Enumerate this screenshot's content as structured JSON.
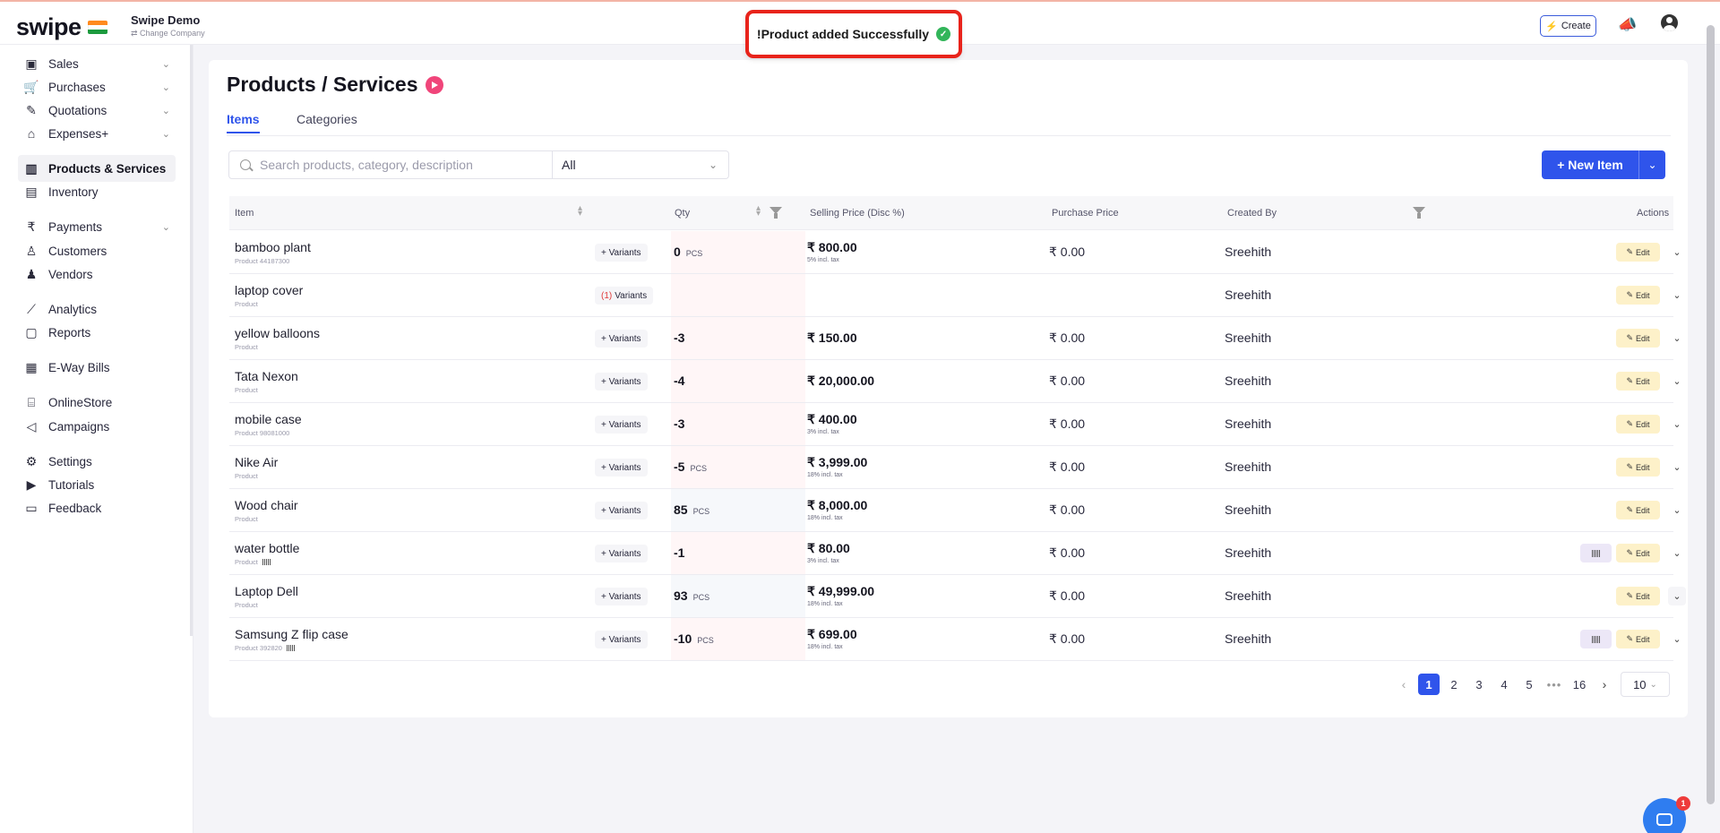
{
  "app": {
    "logo": "swipe",
    "company_name": "Swipe Demo",
    "change_company": "⇄ Change Company"
  },
  "toast": {
    "message": "!Product added Successfully"
  },
  "topbar": {
    "create_label": "Create"
  },
  "sidebar": {
    "items": [
      {
        "label": "Sales",
        "icon": "money-icon",
        "chevron": true
      },
      {
        "label": "Purchases",
        "icon": "cart-icon",
        "chevron": true
      },
      {
        "label": "Quotations",
        "icon": "pen-icon",
        "chevron": true
      },
      {
        "label": "Expenses+",
        "icon": "tag-icon",
        "chevron": true
      },
      {
        "label": "Products & Services",
        "icon": "barcode-icon",
        "chevron": false,
        "active": true
      },
      {
        "label": "Inventory",
        "icon": "inventory-icon",
        "chevron": false
      },
      {
        "label": "Payments",
        "icon": "rupee-icon",
        "chevron": true
      },
      {
        "label": "Customers",
        "icon": "user-icon",
        "chevron": false
      },
      {
        "label": "Vendors",
        "icon": "users-icon",
        "chevron": false
      },
      {
        "label": "Analytics",
        "icon": "chart-icon",
        "chevron": false
      },
      {
        "label": "Reports",
        "icon": "report-icon",
        "chevron": false
      },
      {
        "label": "E-Way Bills",
        "icon": "truck-icon",
        "chevron": false
      },
      {
        "label": "OnlineStore",
        "icon": "store-icon",
        "chevron": false
      },
      {
        "label": "Campaigns",
        "icon": "megaphone-icon",
        "chevron": false
      },
      {
        "label": "Settings",
        "icon": "gear-icon",
        "chevron": false
      },
      {
        "label": "Tutorials",
        "icon": "video-icon",
        "chevron": false
      },
      {
        "label": "Feedback",
        "icon": "chat-icon",
        "chevron": false
      }
    ]
  },
  "page": {
    "title": "Products / Services"
  },
  "tabs": [
    {
      "label": "Items",
      "active": true
    },
    {
      "label": "Categories",
      "active": false
    }
  ],
  "search": {
    "placeholder": "Search products, category, description",
    "filter_value": "All"
  },
  "actions": {
    "new_item_label": "+ New Item"
  },
  "table": {
    "headers": {
      "item": "Item",
      "qty": "Qty",
      "selling_price": "Selling Price (Disc %)",
      "purchase_price": "Purchase Price",
      "created_by": "Created By",
      "actions": "Actions"
    },
    "variants_label": "+ Variants",
    "edit_label": "Edit",
    "rows": [
      {
        "name": "bamboo plant",
        "sub": "Product  44187300",
        "barcode": false,
        "variants_count": "",
        "qty": "0",
        "unit": "PCS",
        "selling": "₹ 800.00",
        "tax": "5% incl. tax",
        "purchase": "₹ 0.00",
        "created_by": "Sreehith",
        "barcode_btn": false,
        "qty_tone": "neg"
      },
      {
        "name": "laptop cover",
        "sub": "Product",
        "barcode": false,
        "variants_count": "(1)",
        "qty": "",
        "unit": "",
        "selling": "",
        "tax": "",
        "purchase": "",
        "created_by": "Sreehith",
        "barcode_btn": false,
        "qty_tone": "neg"
      },
      {
        "name": "yellow balloons",
        "sub": "Product",
        "barcode": false,
        "variants_count": "",
        "qty": "-3",
        "unit": "",
        "selling": "₹ 150.00",
        "tax": "",
        "purchase": "₹ 0.00",
        "created_by": "Sreehith",
        "barcode_btn": false,
        "qty_tone": "neg"
      },
      {
        "name": "Tata Nexon",
        "sub": "Product",
        "barcode": false,
        "variants_count": "",
        "qty": "-4",
        "unit": "",
        "selling": "₹ 20,000.00",
        "tax": "",
        "purchase": "₹ 0.00",
        "created_by": "Sreehith",
        "barcode_btn": false,
        "qty_tone": "neg"
      },
      {
        "name": "mobile case",
        "sub": "Product  98081000",
        "barcode": false,
        "variants_count": "",
        "qty": "-3",
        "unit": "",
        "selling": "₹ 400.00",
        "tax": "3% incl. tax",
        "purchase": "₹ 0.00",
        "created_by": "Sreehith",
        "barcode_btn": false,
        "qty_tone": "neg"
      },
      {
        "name": "Nike Air",
        "sub": "Product",
        "barcode": false,
        "variants_count": "",
        "qty": "-5",
        "unit": "PCS",
        "selling": "₹ 3,999.00",
        "tax": "18% incl. tax",
        "purchase": "₹ 0.00",
        "created_by": "Sreehith",
        "barcode_btn": false,
        "qty_tone": "neg"
      },
      {
        "name": "Wood chair",
        "sub": "Product",
        "barcode": false,
        "variants_count": "",
        "qty": "85",
        "unit": "PCS",
        "selling": "₹ 8,000.00",
        "tax": "18% incl. tax",
        "purchase": "₹ 0.00",
        "created_by": "Sreehith",
        "barcode_btn": false,
        "qty_tone": "pos"
      },
      {
        "name": "water bottle",
        "sub": "Product",
        "barcode": true,
        "variants_count": "",
        "qty": "-1",
        "unit": "",
        "selling": "₹ 80.00",
        "tax": "3% incl. tax",
        "purchase": "₹ 0.00",
        "created_by": "Sreehith",
        "barcode_btn": true,
        "qty_tone": "neg"
      },
      {
        "name": "Laptop Dell",
        "sub": "Product",
        "barcode": false,
        "variants_count": "",
        "qty": "93",
        "unit": "PCS",
        "selling": "₹ 49,999.00",
        "tax": "18% incl. tax",
        "purchase": "₹ 0.00",
        "created_by": "Sreehith",
        "barcode_btn": false,
        "qty_tone": "pos"
      },
      {
        "name": "Samsung Z flip case",
        "sub": "Product  392820",
        "barcode": true,
        "variants_count": "",
        "qty": "-10",
        "unit": "PCS",
        "selling": "₹ 699.00",
        "tax": "18% incl. tax",
        "purchase": "₹ 0.00",
        "created_by": "Sreehith",
        "barcode_btn": true,
        "qty_tone": "neg"
      }
    ]
  },
  "pagination": {
    "pages": [
      "1",
      "2",
      "3",
      "4",
      "5"
    ],
    "dots": "•••",
    "last": "16",
    "current": "1",
    "page_size": "10"
  },
  "chat": {
    "badge": "1"
  },
  "colors": {
    "accent": "#2f54eb",
    "toast_border": "#e8231b",
    "edit_bg": "#fdf1c9"
  }
}
